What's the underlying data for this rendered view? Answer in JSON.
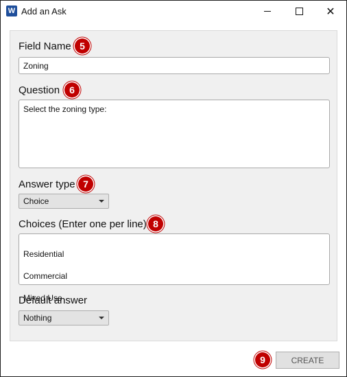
{
  "window": {
    "title": "Add an Ask",
    "app_icon_letter": "W",
    "icons": {
      "app": "word-app-icon",
      "minimize": "minimize-icon",
      "maximize": "maximize-icon",
      "close": "close-icon"
    }
  },
  "form": {
    "field_name": {
      "label": "Field Name",
      "badge": "5",
      "value": "Zoning"
    },
    "question": {
      "label": "Question",
      "badge": "6",
      "value": "Select the zoning type:"
    },
    "answer_type": {
      "label": "Answer type",
      "badge": "7",
      "selected": "Choice"
    },
    "choices": {
      "label": "Choices (Enter one per line)",
      "badge": "8",
      "items": [
        "Residential",
        "Commercial",
        "Mixed Use"
      ]
    },
    "default_answer": {
      "label": "Default answer",
      "selected": "Nothing"
    }
  },
  "footer": {
    "create_label": "CREATE",
    "badge": "9"
  },
  "colors": {
    "badge": "#c00000",
    "panel_bg": "#f0f0f0",
    "word_blue": "#1e4e9b"
  }
}
